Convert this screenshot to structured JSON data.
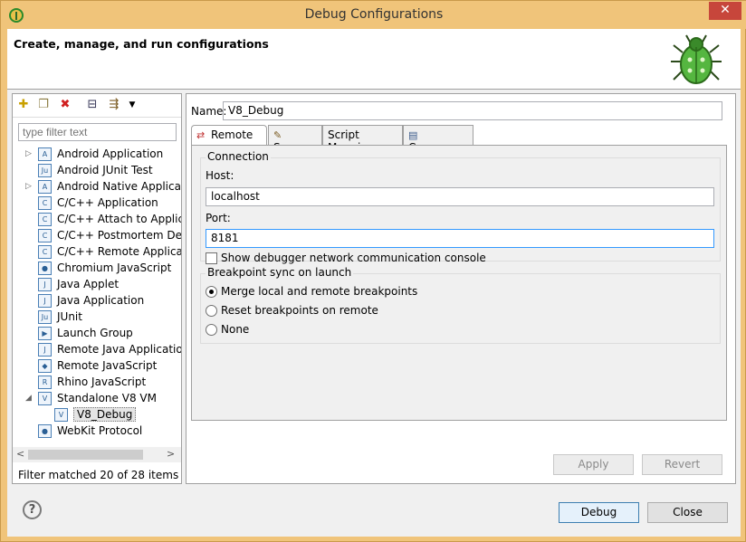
{
  "window": {
    "title": "Debug Configurations",
    "close_glyph": "✕"
  },
  "banner": {
    "title": "Create, manage, and run configurations"
  },
  "left": {
    "filter_placeholder": "type filter text",
    "toolbar": [
      "new-config-icon",
      "duplicate-icon",
      "delete-icon",
      "collapse-all-icon",
      "filter-icon"
    ],
    "items": [
      {
        "label": "Android Application",
        "icon": "android-app-icon",
        "expand": "▷",
        "abbr": "A"
      },
      {
        "label": "Android JUnit Test",
        "icon": "junit-icon",
        "expand": "",
        "abbr": "Ju"
      },
      {
        "label": "Android Native Applicati",
        "icon": "android-native-icon",
        "expand": "▷",
        "abbr": "A"
      },
      {
        "label": "C/C++ Application",
        "icon": "cpp-app-icon",
        "expand": "",
        "abbr": "C"
      },
      {
        "label": "C/C++ Attach to Applica",
        "icon": "cpp-attach-icon",
        "expand": "",
        "abbr": "C"
      },
      {
        "label": "C/C++ Postmortem Debu",
        "icon": "cpp-postmortem-icon",
        "expand": "",
        "abbr": "C"
      },
      {
        "label": "C/C++ Remote Applicati",
        "icon": "cpp-remote-icon",
        "expand": "",
        "abbr": "C"
      },
      {
        "label": "Chromium JavaScript",
        "icon": "chromium-icon",
        "expand": "",
        "abbr": "●"
      },
      {
        "label": "Java Applet",
        "icon": "java-applet-icon",
        "expand": "",
        "abbr": "J"
      },
      {
        "label": "Java Application",
        "icon": "java-app-icon",
        "expand": "",
        "abbr": "J"
      },
      {
        "label": "JUnit",
        "icon": "junit-icon",
        "expand": "",
        "abbr": "Ju"
      },
      {
        "label": "Launch Group",
        "icon": "launch-group-icon",
        "expand": "",
        "abbr": "▶"
      },
      {
        "label": "Remote Java Application",
        "icon": "remote-java-icon",
        "expand": "",
        "abbr": "J"
      },
      {
        "label": "Remote JavaScript",
        "icon": "remote-js-icon",
        "expand": "",
        "abbr": "◆"
      },
      {
        "label": "Rhino JavaScript",
        "icon": "rhino-icon",
        "expand": "",
        "abbr": "R"
      },
      {
        "label": "Standalone V8 VM",
        "icon": "v8-vm-icon",
        "expand": "◢",
        "abbr": "V"
      },
      {
        "label": "V8_Debug",
        "icon": "v8-debug-icon",
        "expand": "",
        "abbr": "V",
        "child": true,
        "selected": true
      },
      {
        "label": "WebKit Protocol",
        "icon": "webkit-icon",
        "expand": "",
        "abbr": "●"
      }
    ],
    "status": "Filter matched 20 of 28 items"
  },
  "right": {
    "name_label": "Name:",
    "name_value": "V8_Debug",
    "tabs": [
      {
        "label": "Remote",
        "icon": "remote-tab-icon",
        "glyph": "⇄",
        "active": true
      },
      {
        "label": "Source",
        "icon": "source-tab-icon",
        "glyph": "✎"
      },
      {
        "label": "Script Mapping",
        "icon": "",
        "glyph": ""
      },
      {
        "label": "Common",
        "icon": "common-tab-icon",
        "glyph": "▤"
      }
    ],
    "connection": {
      "title": "Connection",
      "host_label": "Host:",
      "host_value": "localhost",
      "port_label": "Port:",
      "port_value": "8181",
      "show_console_label": "Show debugger network communication console"
    },
    "breakpoints": {
      "title": "Breakpoint sync on launch",
      "options": [
        "Merge local and remote breakpoints",
        "Reset breakpoints on remote",
        "None"
      ],
      "selected": 0
    },
    "apply_label": "Apply",
    "revert_label": "Revert"
  },
  "footer": {
    "debug_label": "Debug",
    "close_label": "Close",
    "help_glyph": "?"
  }
}
